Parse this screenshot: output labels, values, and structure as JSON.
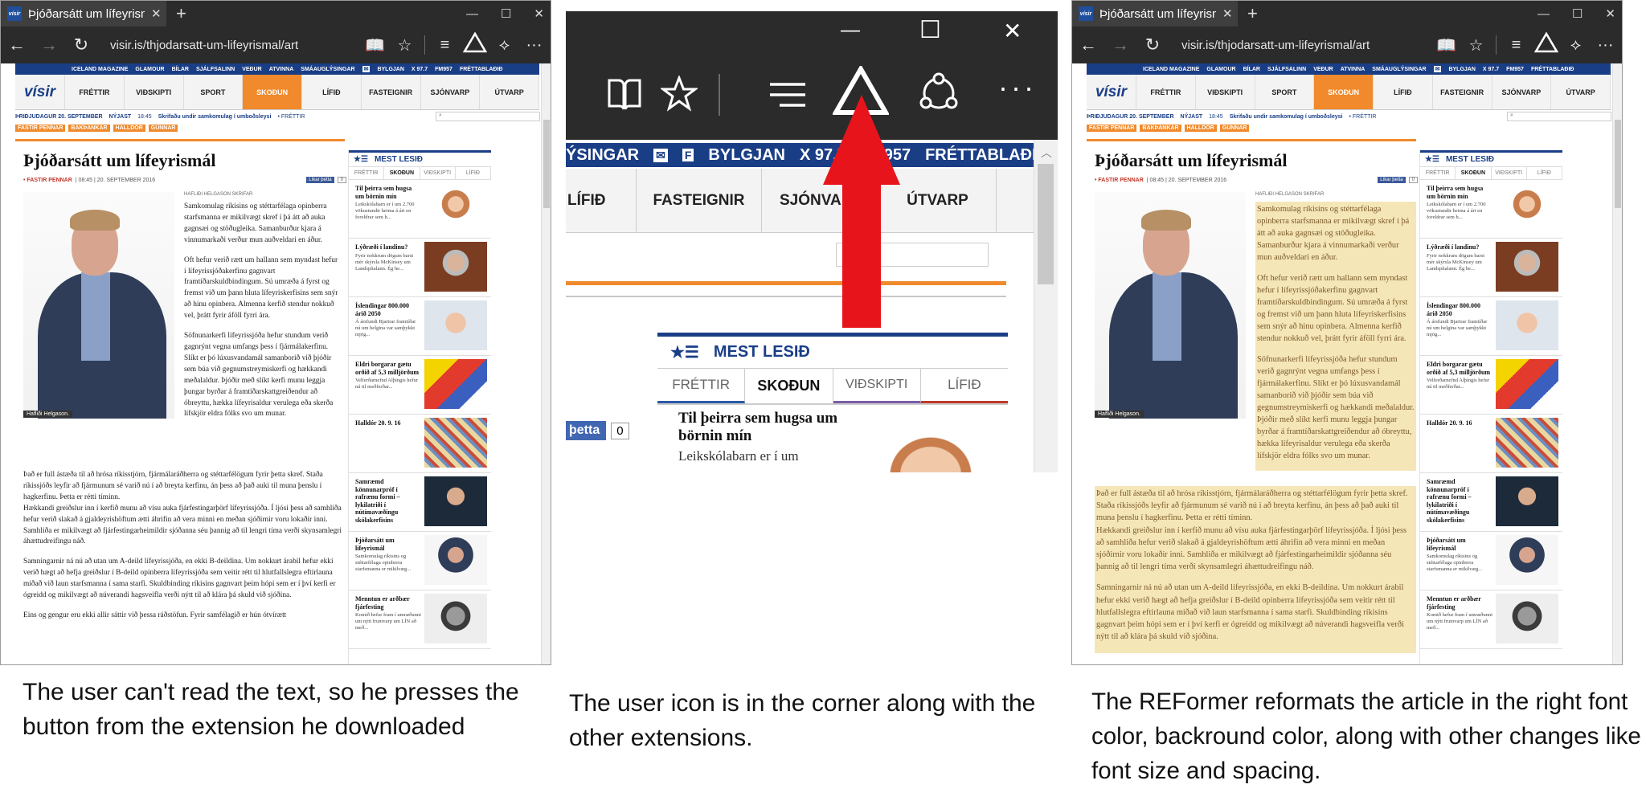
{
  "browser": {
    "tab_title": "Þjóðarsátt um lífeyrismál",
    "favicon_text": "vísir",
    "address": "visir.is/thjodarsatt-um-lifeyrismal/artic"
  },
  "site": {
    "logo": "vísir",
    "top_links": [
      "ICELAND MAGAZINE",
      "GLAMOUR",
      "BÍLAR",
      "SJÁLFSALINN",
      "VEÐUR",
      "ATVINNA",
      "SMÁAUGLÝSINGAR",
      "BYLGJAN",
      "X 97.7",
      "FM957",
      "FRÉTTABLAÐIÐ"
    ],
    "nav": [
      "FRÉTTIR",
      "VIÐSKIPTI",
      "SPORT",
      "SKOÐUN",
      "LÍFIÐ",
      "FASTEIGNIR",
      "SJÓNVARP",
      "ÚTVARP"
    ],
    "date": "ÞRIÐJUDAGUR 20. SEPTEMBER",
    "newest_label": "NÝJAST",
    "newest_time": "18:45",
    "newest_text": "Skrifaðu undir samkomulag í umboðsleysi",
    "newest_tag": "• FRÉTTIR",
    "crumbs": [
      "FASTIR PENNAR",
      "BAKÞANKAR",
      "HALLDÓR",
      "GUNNAR"
    ]
  },
  "article": {
    "headline": "Þjóðarsátt um lífeyrismál",
    "category": "• FASTIR PENNAR",
    "meta_time": "| 08:45 | 20. SEPTEMBER 2016",
    "like_label": "Líkar þetta",
    "like_count": "0",
    "author": "HAFLIÐI HELGASON SKRIFAR",
    "photo_caption": "Hafliði Helgason.",
    "p1": "Samkomulag ríkisins og stéttarfélaga opinberra starfsmanna er mikilvægt skref í þá átt að auka gagnsæi og stöðugleika. Samanburður kjara á vinnumarkaði verður mun auðveldari en áður.",
    "p2": "Oft hefur verið rætt um hallann sem myndast hefur í lífeyrissjóðakerfinu gagnvart framtíðarskuldbindingum. Sú umræða á fyrst og fremst við um þann hluta lífeyriskerfisins sem snýr að hinu opinbera. Almenna kerfið stendur nokkuð vel, þrátt fyrir áföll fyrri ára.",
    "p3": "Söfnunarkerfi lífeyrissjóða hefur stundum verið gagnrýnt vegna umfangs þess í fjármálakerfinu. Slíkt er þó lúxusvandamál samanborið við þjóðir sem búa við gegnumstreymiskerfi og hækkandi meðalaldur. Þjóðir með slíkt kerfi munu leggja þungar byrðar á framtíðarskattgreiðendur að óbreyttu, hækka lífeyrisaldur verulega eða skerða lífskjör eldra fólks svo um munar.",
    "p4": "Það er full ástæða til að hrósa ríkisstjórn, fjármálaráðherra og stéttarfélögum fyrir þetta skref. Staða ríkissjóðs leyfir að fjármunum sé varið nú í að breyta kerfinu, án þess að það auki til muna þenslu í hagkerfinu. Þetta er rétti tíminn.",
    "p5": "Hækkandi greiðslur inn í kerfið munu að vísu auka fjárfestingarþörf lífeyrissjóða. Í ljósi þess að samhliða hefur verið slakað á gjaldeyrishöftum ætti áhrifin að vera minni en meðan sjóðirnir voru lokaðir inni. Samhliða er mikilvægt að fjárfestingarheimildir sjóðanna séu þannig að til lengri tíma verði skynsamlegri áhættudreifingu náð.",
    "p6": "Samningarnir ná nú að utan um A-deild lífeyrissjóða, en ekki B-deildina. Um nokkurt árabil hefur ekki verið hægt að hefja greiðslur í B-deild opinberra lífeyrissjóða sem veitir rétt til hlutfallslegra eftirlauna miðað við laun starfsmanna í sama starfi. Skuldbinding ríkisins gagnvart þeim hópi sem er í því kerfi er ógreidd og mikilvægt að núverandi hagsveifla verði nýtt til að klára þá skuld við sjóðina.",
    "p7": "Eins og gengur eru ekki allir sáttir við þessa ráðstöfun. Fyrir samfélagið er hún ótvírætt"
  },
  "sidebar": {
    "title": "MEST LESIÐ",
    "tabs": [
      "FRÉTTIR",
      "SKOÐUN",
      "VIÐSKIPTI",
      "LÍFIÐ"
    ],
    "items": [
      {
        "title": "Til þeirra sem hugsa um börnin mín",
        "sub": "Leikskólabarn er í um 2.700 vökustundir heima á ári en foreldrar sem h..."
      },
      {
        "title": "Lýðræði í landinu?",
        "sub": "Fyrir nokkrum dögum barst mér skýrsla McKinsey um Landspítalann. Ég he..."
      },
      {
        "title": "Íslendingar 800.000 árið 2050",
        "sub": "Á ársfundi Bjartrar framtíðar nú um helgina var samþykkt mjög..."
      },
      {
        "title": "Eldri borgarar gætu orðið af 5,3 milljörðum",
        "sub": "Velferðarnefnd Alþingis hefur nú til meðferðar..."
      },
      {
        "title": "Halldór 20. 9. 16",
        "sub": ""
      },
      {
        "title": "Samræmd könnunarpróf í rafrænu formi – lykilatriði í nútímavæðingu skólakerfisins",
        "sub": ""
      },
      {
        "title": "Þjóðarsátt um lífeyrismál",
        "sub": "Samkomulag ríkisins og stéttarfélaga opinberra starfsmanna er mikilvæg..."
      },
      {
        "title": "Menntun er arðbær fjárfesting",
        "sub": "Komið hefur fram í umræðunni um nýtt frumvarp um LÍN að með..."
      }
    ]
  },
  "zoom": {
    "minimize": "—",
    "maximize": "☐",
    "close": "✕",
    "strip_left": "ÝSINGAR",
    "strip_items": [
      "BYLGJAN",
      "X 97.7",
      "FM957",
      "FRÉTTABLAÐIÐ"
    ],
    "nav": [
      "LÍFIÐ",
      "FASTEIGNIR",
      "SJÓNVARP",
      "ÚTVARP"
    ],
    "mest_title": "MEST LESIÐ",
    "tabs": [
      "FRÉTTIR",
      "SKOÐUN",
      "VIÐSKIPTI",
      "LÍFIÐ"
    ],
    "item_title": "Til þeirra sem hugsa um börnin mín",
    "item_sub": "Leikskólabarn er í um",
    "like_label": "þetta",
    "like_count": "0",
    "arrow_color": "#e8141b"
  },
  "captions": {
    "left": "The user can't read the text, so he presses the button from the extension he downloaded",
    "middle": "The user icon is in the corner along with the other extensions.",
    "right": "The REFormer reformats the article in the right font color, backround color, along with other changes like font size and spacing."
  }
}
